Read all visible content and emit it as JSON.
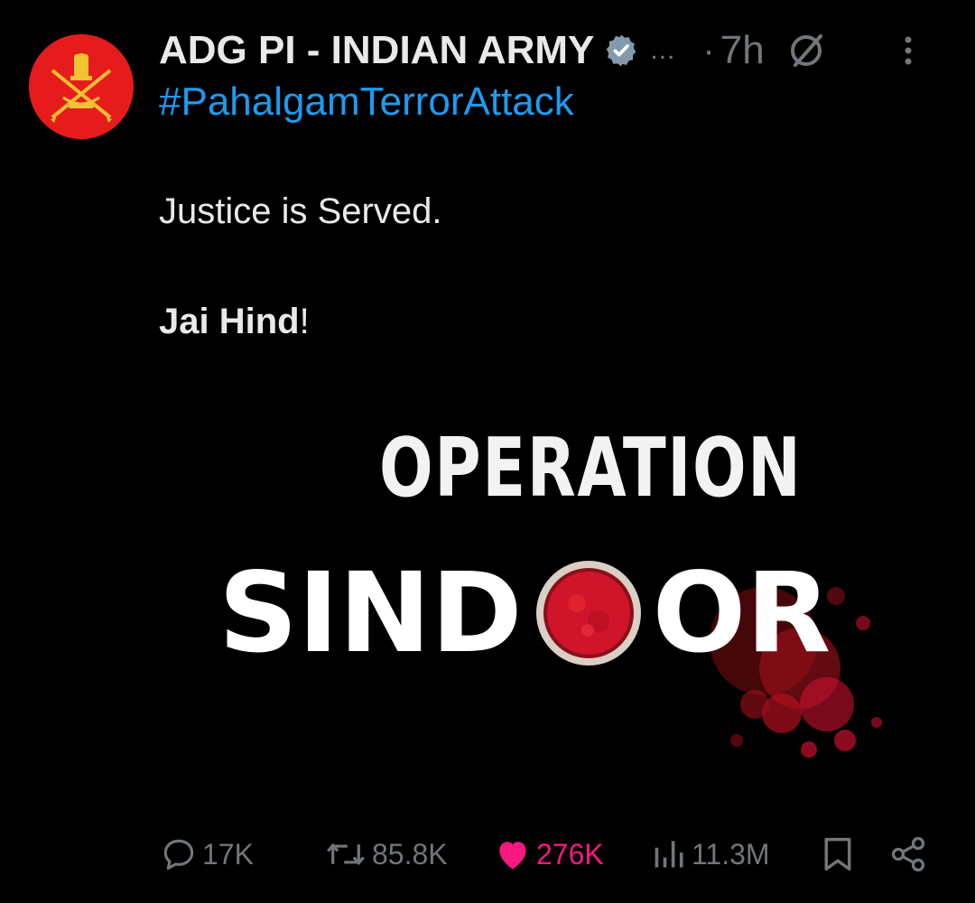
{
  "author": {
    "name": "ADG PI - INDIAN ARMY",
    "handle_truncated": "...",
    "time_separator": "·",
    "timestamp": "7h"
  },
  "tweet": {
    "hashtag": "#PahalgamTerrorAttack",
    "line1": "Justice is Served.",
    "line2_bold": "Jai Hind",
    "line2_rest": "!"
  },
  "media": {
    "title_top": "OPERATION",
    "title_main_start": "SIND",
    "title_main_end": "OR"
  },
  "actions": {
    "replies": "17K",
    "reposts": "85.8K",
    "likes": "276K",
    "views": "11.3M"
  },
  "colors": {
    "background": "#000000",
    "text": "#e7e9ea",
    "muted": "#71767b",
    "link": "#1d9bf0",
    "like": "#f91880",
    "avatar": "#e61c1c",
    "sindoor_red": "#c8102e"
  },
  "icons": [
    "army-emblem-avatar",
    "verified-badge-icon",
    "grok-icon",
    "more-icon",
    "reply-icon",
    "repost-icon",
    "like-icon",
    "views-icon",
    "bookmark-icon",
    "share-icon"
  ]
}
